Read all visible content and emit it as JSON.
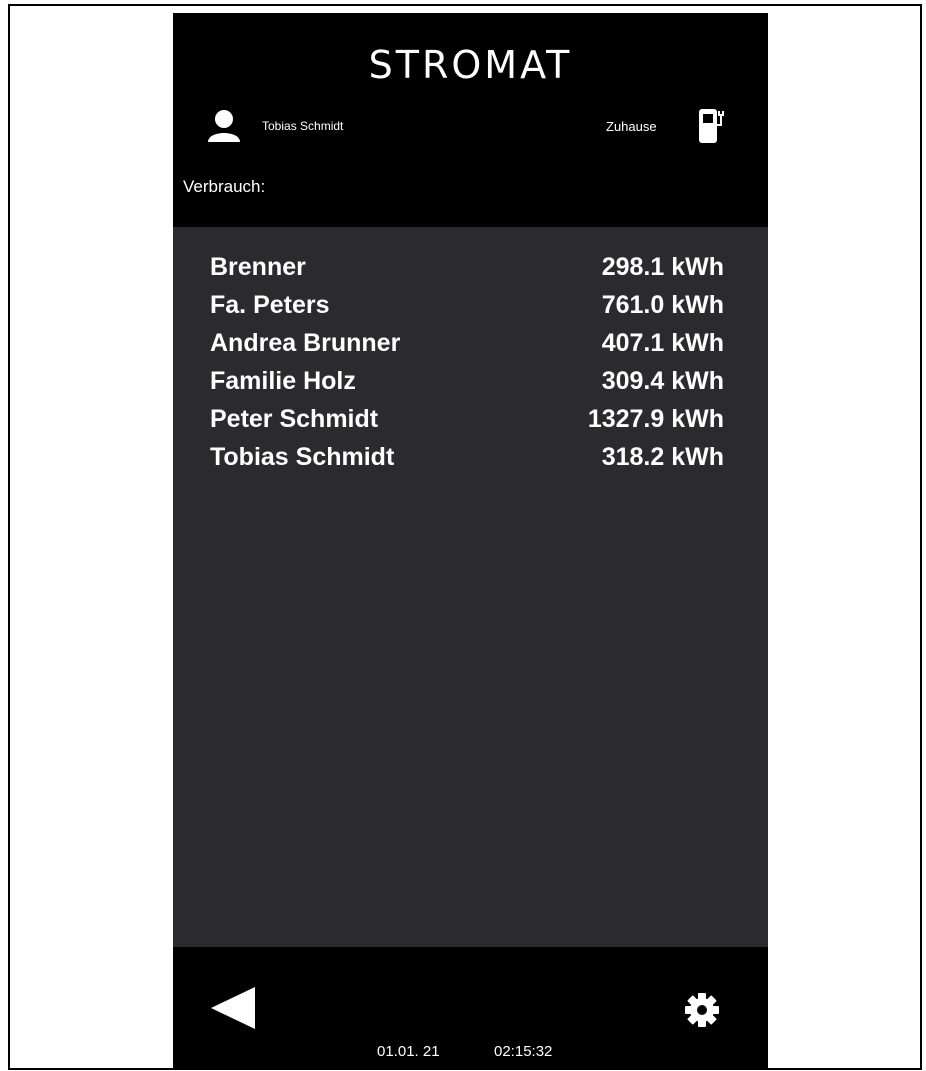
{
  "header": {
    "logo": "STROMAT",
    "user_name": "Tobias Schmidt",
    "location": "Zuhause",
    "section_label": "Verbrauch:"
  },
  "consumption": [
    {
      "name": "Brenner",
      "value": "298.1 kWh"
    },
    {
      "name": "Fa. Peters",
      "value": "761.0 kWh"
    },
    {
      "name": "Andrea Brunner",
      "value": "407.1 kWh"
    },
    {
      "name": "Familie Holz",
      "value": "309.4 kWh"
    },
    {
      "name": "Peter Schmidt",
      "value": "1327.9 kWh"
    },
    {
      "name": "Tobias Schmidt",
      "value": "318.2 kWh"
    }
  ],
  "footer": {
    "date": "01.01. 21",
    "time": "02:15:32"
  },
  "icons": {
    "user": "user-icon",
    "station": "charging-station-icon",
    "back": "back-arrow-icon",
    "settings": "gear-icon"
  },
  "colors": {
    "header_bg": "#000000",
    "content_bg": "#2b2b2e",
    "text": "#ffffff"
  }
}
